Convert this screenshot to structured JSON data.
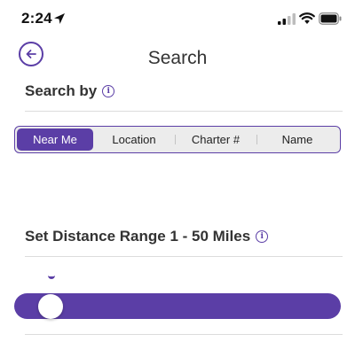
{
  "status_bar": {
    "time": "2:24",
    "icons": [
      "location-arrow-icon",
      "signal-icon",
      "wifi-icon",
      "battery-icon"
    ]
  },
  "header": {
    "title": "Search",
    "back_icon": "back-arrow-icon"
  },
  "search_by": {
    "heading": "Search by",
    "info_glyph": "i",
    "segments": [
      "Near Me",
      "Location",
      "Charter #",
      "Name"
    ],
    "selected_segment": "Near Me"
  },
  "distance": {
    "heading": "Set Distance Range 1 - 50 Miles",
    "info_glyph": "i",
    "slider_min": 1,
    "slider_max": 50,
    "slider_value_fraction": 0.1
  },
  "colors": {
    "accent": "#5b3ea6",
    "segment_bg": "#ececec",
    "divider": "#dcdcdc"
  }
}
